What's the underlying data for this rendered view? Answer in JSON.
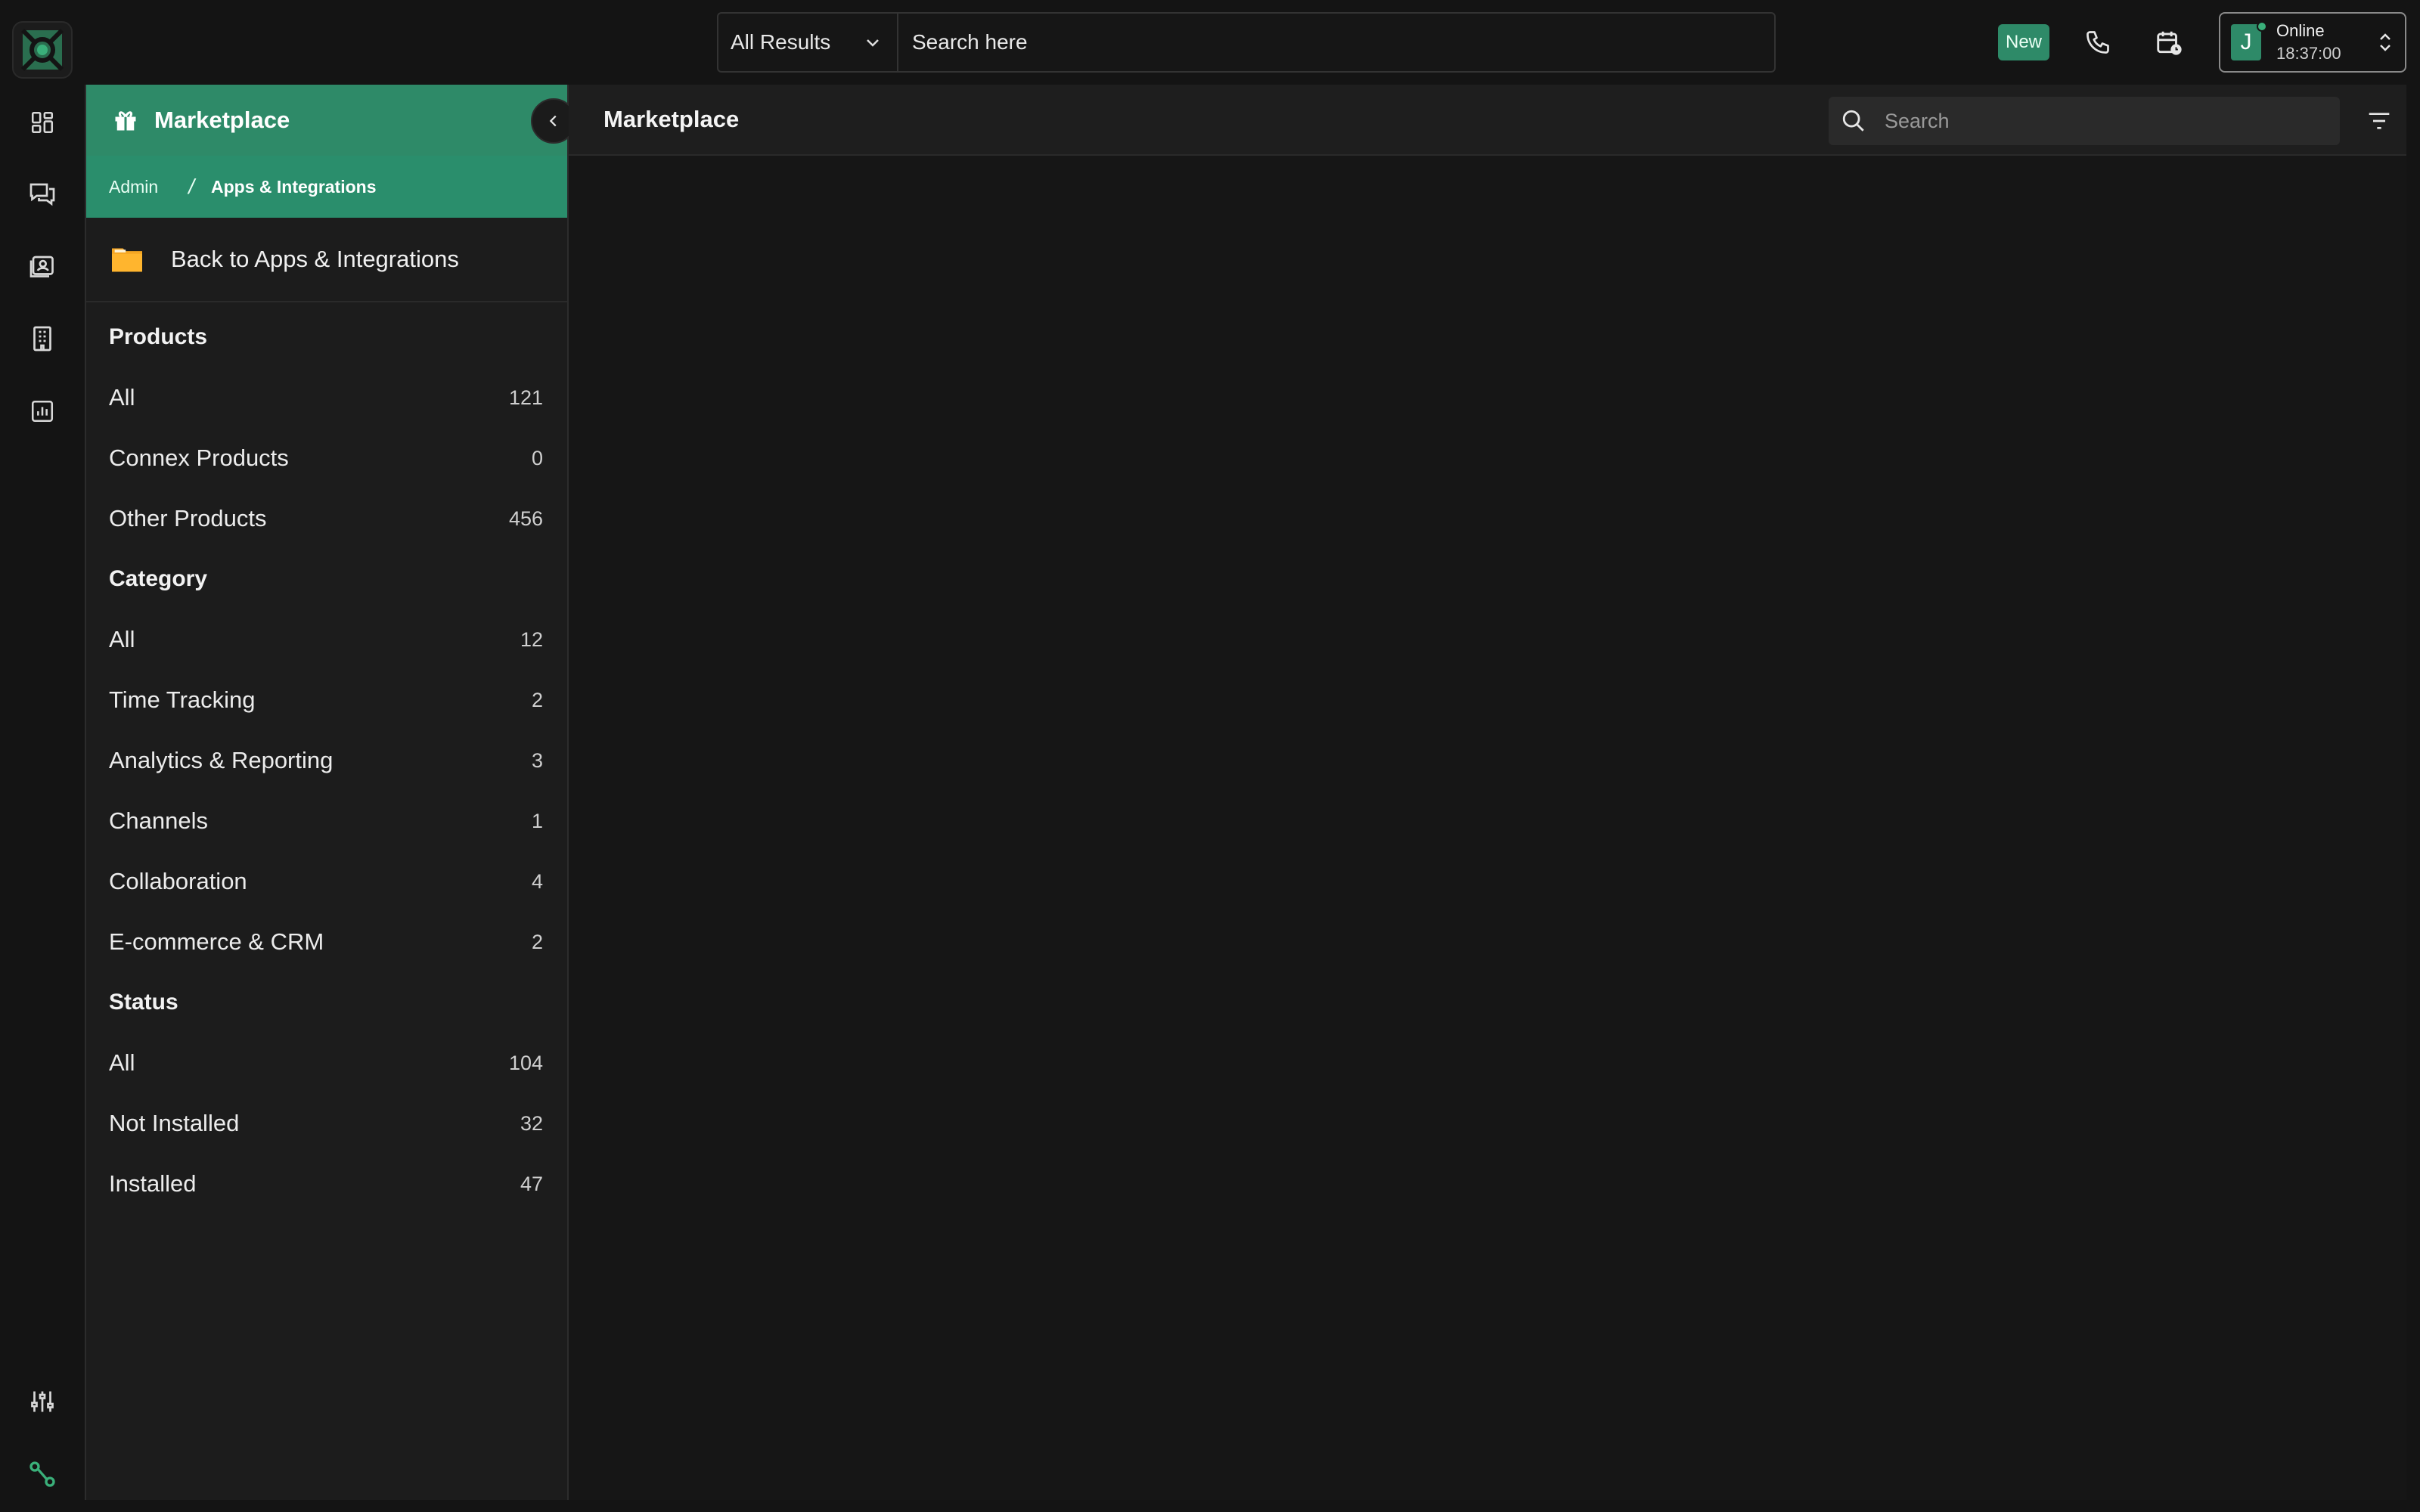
{
  "topbar": {
    "scope_select": "All Results",
    "search_placeholder": "Search here",
    "new_badge": "New",
    "user": {
      "initial": "J",
      "status": "Online",
      "time": "18:37:00"
    }
  },
  "rail": {
    "icons": [
      "dashboard-icon",
      "conversations-icon",
      "contacts-icon",
      "building-icon",
      "reports-icon",
      "settings-sliders-icon",
      "integrations-icon"
    ]
  },
  "sidebar": {
    "title": "Marketplace",
    "breadcrumb": {
      "root": "Admin",
      "separator": "/",
      "current": "Apps & Integrations"
    },
    "back_label": "Back to Apps & Integrations",
    "sections": {
      "products": {
        "title": "Products",
        "items": [
          {
            "label": "All",
            "count": "121"
          },
          {
            "label": "Connex Products",
            "count": "0"
          },
          {
            "label": "Other Products",
            "count": "456"
          }
        ]
      },
      "category": {
        "title": "Category",
        "items": [
          {
            "label": "All",
            "count": "12"
          },
          {
            "label": "Time Tracking",
            "count": "2"
          },
          {
            "label": "Analytics & Reporting",
            "count": "3"
          },
          {
            "label": "Channels",
            "count": "1"
          },
          {
            "label": "Collaboration",
            "count": "4"
          },
          {
            "label": "E-commerce & CRM",
            "count": "2"
          }
        ]
      },
      "status": {
        "title": "Status",
        "items": [
          {
            "label": "All",
            "count": "104"
          },
          {
            "label": "Not Installed",
            "count": "32"
          },
          {
            "label": "Installed",
            "count": "47"
          }
        ]
      }
    }
  },
  "main": {
    "title": "Marketplace",
    "search_placeholder": "Search"
  },
  "colors": {
    "accent": "#2e8a68",
    "background": "#141414",
    "panel": "#1c1c1c"
  }
}
